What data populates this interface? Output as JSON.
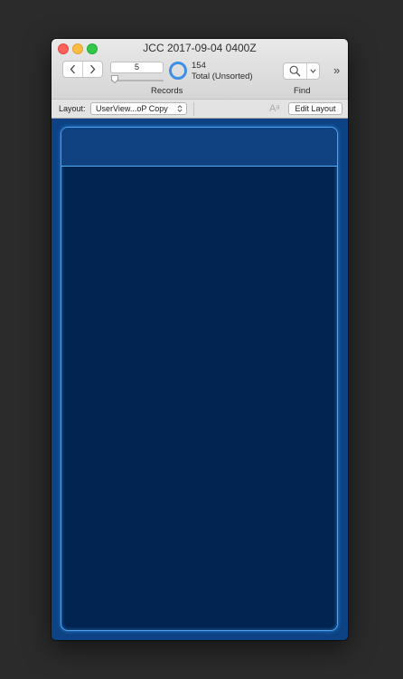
{
  "window": {
    "title": "JCC 2017-09-04 0400Z"
  },
  "toolbar": {
    "current_record": "5",
    "record_count": "154",
    "total_status": "Total (Unsorted)",
    "records_label": "Records",
    "find_label": "Find",
    "overflow_glyph": "»"
  },
  "layoutbar": {
    "layout_label": "Layout:",
    "layout_name": "UserView...oP Copy",
    "text_format_glyph": "Aᵃ",
    "edit_layout_label": "Edit Layout"
  },
  "icons": {
    "prev": "chevron-left-icon",
    "next": "chevron-right-icon",
    "find": "search-icon",
    "find_menu": "chevron-down-icon",
    "layout_menu": "chevron-updown-icon"
  },
  "colors": {
    "content_background": "#0d4384",
    "panel_background": "#012450",
    "panel_border": "#4da3f0",
    "panel_header": "#104282",
    "pie_accent": "#3f8fe4"
  }
}
